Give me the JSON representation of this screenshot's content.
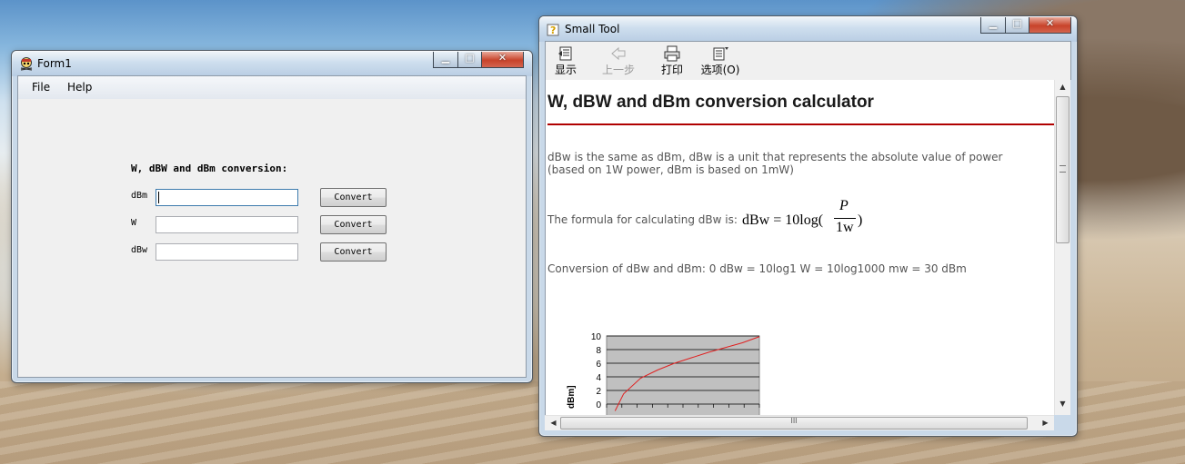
{
  "form1": {
    "title": "Form1",
    "menu": [
      "File",
      "Help"
    ],
    "heading": "W, dBW and dBm conversion:",
    "rows": [
      {
        "label": "dBm",
        "value": "",
        "button": "Convert"
      },
      {
        "label": "W",
        "value": "",
        "button": "Convert"
      },
      {
        "label": "dBw",
        "value": "",
        "button": "Convert"
      }
    ]
  },
  "smalltool": {
    "title": "Small Tool",
    "toolbar": [
      {
        "label": "显示",
        "icon": "show-pane-icon",
        "enabled": true
      },
      {
        "label": "上一步",
        "icon": "back-arrow-icon",
        "enabled": false
      },
      {
        "label": "打印",
        "icon": "printer-icon",
        "enabled": true
      },
      {
        "label": "选项(O)",
        "icon": "options-icon",
        "enabled": true
      }
    ],
    "doc": {
      "title": "W, dBW and dBm conversion calculator",
      "para1": "dBw is the same as dBm, dBw is a unit that represents the absolute value of power (based on 1W power, dBm is based on 1mW)",
      "formula_intro": "The formula for calculating dBw is:",
      "formula": {
        "lhs": "dBw = 10log(",
        "num": "P",
        "den": "1w",
        "rhs": ")"
      },
      "para3": "Conversion of dBw and dBm: 0 dBw = 10log1 W = 10log1000 mw = 30 dBm"
    },
    "scroll": {
      "h_grip": "III"
    }
  },
  "chart_data": {
    "type": "line",
    "ylabel": "dBm]",
    "ylim": [
      0,
      10
    ],
    "yticks": [
      "10",
      "8",
      "6",
      "4",
      "2",
      "0"
    ],
    "series": [
      {
        "x": [
          1.5,
          2,
          3,
          4,
          5,
          6,
          7,
          8,
          9,
          10
        ],
        "values": [
          -1.0,
          1.5,
          3.8,
          5.0,
          6.0,
          6.8,
          7.6,
          8.3,
          9.0,
          9.9
        ]
      }
    ],
    "colors": {
      "line": "#e02020",
      "plot_bg": "#c0c0c0"
    }
  }
}
